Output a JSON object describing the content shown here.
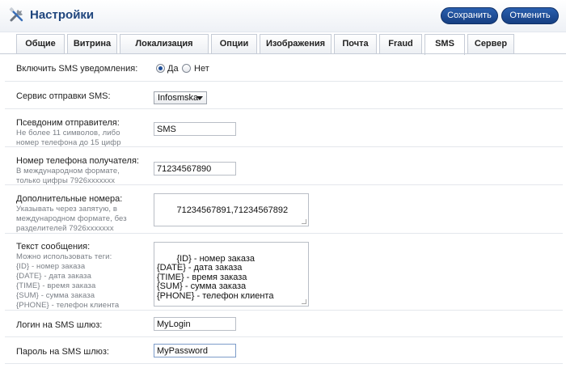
{
  "header": {
    "title": "Настройки",
    "save_label": "Сохранить",
    "cancel_label": "Отменить"
  },
  "tabs": [
    {
      "label": "Общие"
    },
    {
      "label": "Витрина"
    },
    {
      "label": "Локализация"
    },
    {
      "label": "Опции"
    },
    {
      "label": "Изображения"
    },
    {
      "label": "Почта"
    },
    {
      "label": "Fraud"
    },
    {
      "label": "SMS",
      "active": true
    },
    {
      "label": "Сервер"
    }
  ],
  "form": {
    "sms_enabled": {
      "label": "Включить SMS уведомления:",
      "option_yes": "Да",
      "option_no": "Нет",
      "selected": "Да"
    },
    "service": {
      "label": "Сервис отправки SMS:",
      "value": "Infosmska"
    },
    "sender": {
      "label": "Псевдоним отправителя:",
      "hint_1": "Не более 11 символов, либо",
      "hint_2": "номер телефона до 15 цифр",
      "value": "SMS"
    },
    "phone": {
      "label": "Номер телефона получателя:",
      "hint_1": "В международном формате,",
      "hint_2": "только цифры 7926xxxxxxx",
      "value": "71234567890"
    },
    "extra_numbers": {
      "label": "Дополнительные номера:",
      "hint_1": "Указывать через запятую, в",
      "hint_2": "международном формате, без",
      "hint_3": "разделителей 7926xxxxxxx",
      "value": "71234567891,71234567892"
    },
    "message": {
      "label": "Текст сообщения:",
      "hint_1": "Можно использовать теги:",
      "hint_2": "{ID} - номер заказа",
      "hint_3": "{DATE} - дата заказа",
      "hint_4": "{TIME} - время заказа",
      "hint_5": "{SUM} - сумма заказа",
      "hint_6": "{PHONE} - телефон клиента",
      "value": "{ID} - номер заказа\n{DATE} - дата заказа\n{TIME} - время заказа\n{SUM} - сумма заказа\n{PHONE} - телефон клиента"
    },
    "login": {
      "label": "Логин на SMS шлюз:",
      "value": "MyLogin"
    },
    "password": {
      "label": "Пароль на SMS шлюз:",
      "value": "MyPassword"
    }
  }
}
